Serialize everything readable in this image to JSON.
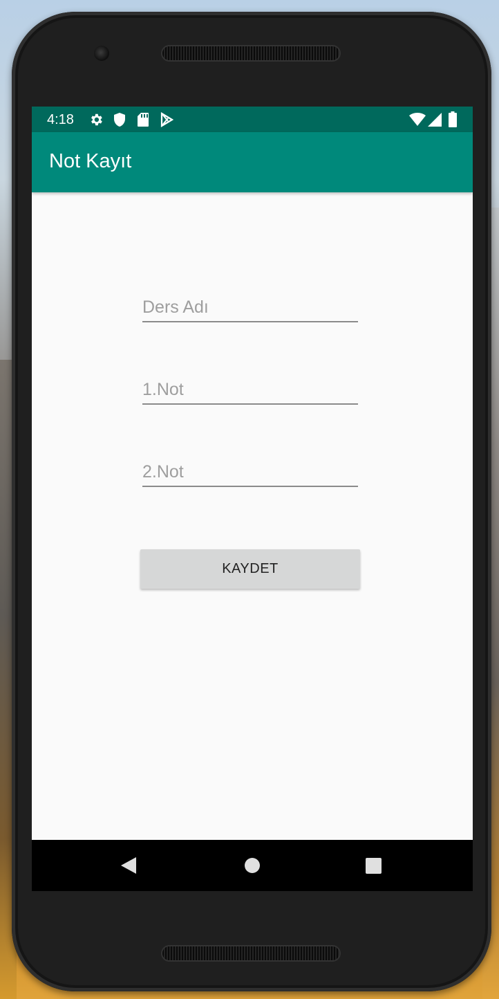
{
  "status_bar": {
    "time": "4:18",
    "icons": [
      "gear-icon",
      "shield-icon",
      "sd-card-icon",
      "play-store-icon",
      "wifi-icon",
      "cell-signal-icon",
      "battery-icon"
    ]
  },
  "app_bar": {
    "title": "Not Kayıt"
  },
  "form": {
    "lesson_name": {
      "placeholder": "Ders Adı",
      "value": ""
    },
    "grade_1": {
      "placeholder": "1.Not",
      "value": ""
    },
    "grade_2": {
      "placeholder": "2.Not",
      "value": ""
    },
    "save_label": "KAYDET"
  },
  "nav_bar": {
    "buttons": [
      "back-icon",
      "home-icon",
      "recents-icon"
    ]
  },
  "colors": {
    "status_bar": "#00695c",
    "app_bar": "#00897b",
    "background": "#fafafa",
    "button": "#d6d7d7"
  }
}
